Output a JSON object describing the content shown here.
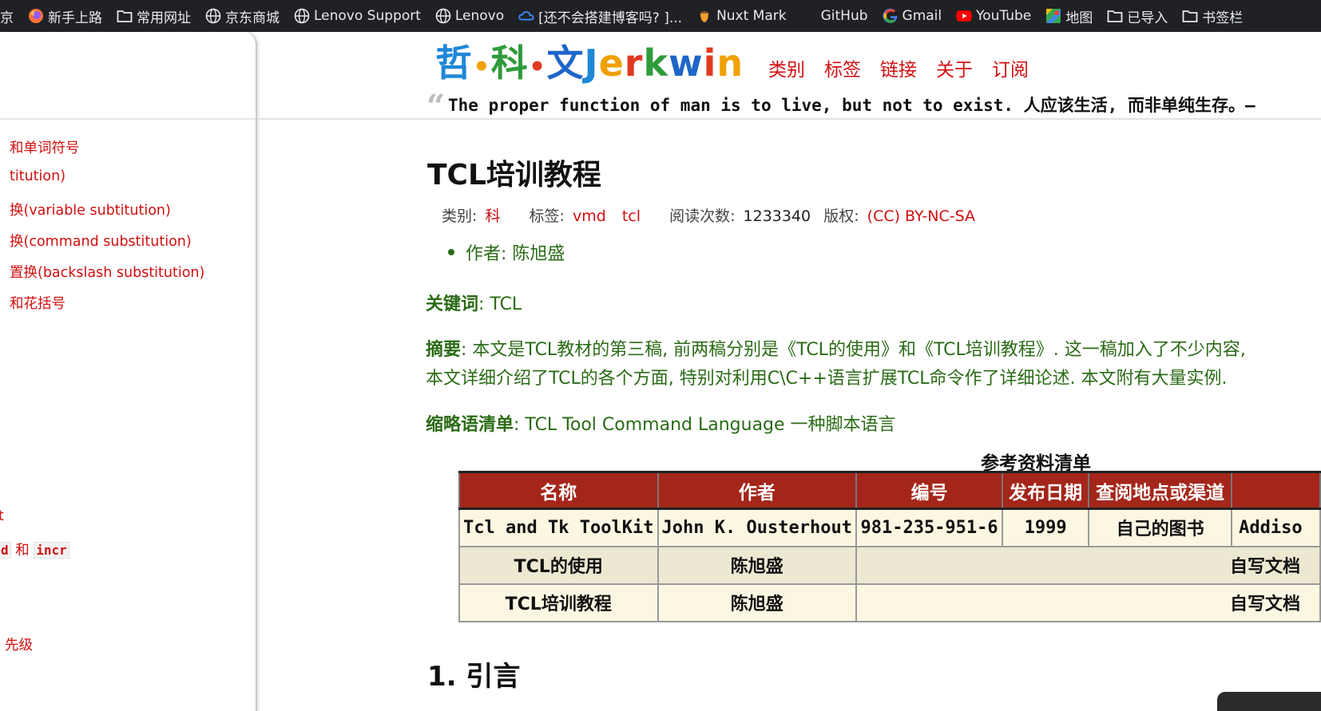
{
  "bookmarks": [
    {
      "label": "京",
      "icon": "partial-icon"
    },
    {
      "label": "新手上路",
      "icon": "firefox-icon"
    },
    {
      "label": "常用网址",
      "icon": "folder-icon"
    },
    {
      "label": "京东商城",
      "icon": "globe-icon"
    },
    {
      "label": "Lenovo Support",
      "icon": "globe-icon"
    },
    {
      "label": "Lenovo",
      "icon": "globe-icon"
    },
    {
      "label": "[还不会搭建博客吗? ]...",
      "icon": "cloud-icon"
    },
    {
      "label": "Nuxt Mark",
      "icon": "acorn-icon"
    },
    {
      "label": "GitHub",
      "icon": "github-icon"
    },
    {
      "label": "Gmail",
      "icon": "google-icon"
    },
    {
      "label": "YouTube",
      "icon": "youtube-icon"
    },
    {
      "label": "地图",
      "icon": "maps-icon"
    },
    {
      "label": "已导入",
      "icon": "folder-icon"
    },
    {
      "label": "书签栏",
      "icon": "folder-icon"
    }
  ],
  "sidebar": {
    "items": [
      {
        "label": "和单词符号"
      },
      {
        "label": "titution)"
      },
      {
        "label": "换(variable subtitution)"
      },
      {
        "label": "换(command substitution)"
      },
      {
        "label": "置换(backslash substitution)"
      },
      {
        "label": "和花括号"
      },
      {
        "label": "t"
      },
      {
        "label_code1": "d",
        "label_mid": " 和 ",
        "label_code2": "incr"
      },
      {
        "label": "先级"
      }
    ]
  },
  "header": {
    "logo": {
      "part1": "哲",
      "dot": "•",
      "part2": "科",
      "part3": "文",
      "J": "J",
      "e": "e",
      "r": "r",
      "k": "k",
      "w": "w",
      "i": "i",
      "n": "n"
    },
    "nav": [
      "类别",
      "标签",
      "链接",
      "关于",
      "订阅"
    ],
    "quote_mark": "“",
    "quote": "The proper function of man is to live, but not to exist. 人应该生活, 而非单纯生存。—"
  },
  "article": {
    "title": "TCL培训教程",
    "meta": {
      "category_label": "类别:",
      "category": "科",
      "tags_label": "标签:",
      "tag1": "vmd",
      "tag2": "tcl",
      "reads_label": "阅读次数:",
      "reads": "1233340",
      "license_label": "版权:",
      "license": "(CC) BY-NC-SA"
    },
    "author": "作者: 陈旭盛",
    "keywords_label": "关键词",
    "keywords": ": TCL",
    "abstract_label": "摘要",
    "abstract_line1": ": 本文是TCL教材的第三稿, 前两稿分别是《TCL的使用》和《TCL培训教程》. 这一稿加入了不少内容,",
    "abstract_line2": "本文详细介绍了TCL的各个方面, 特别对利用C\\C++语言扩展TCL命令作了详细论述. 本文附有大量实例.",
    "abbr_label": "缩略语清单",
    "abbr": ": TCL Tool Command Language 一种脚本语言",
    "table_caption": "参考资料清单",
    "table_headers": [
      "名称",
      "作者",
      "编号",
      "发布日期",
      "查阅地点或渠道",
      ""
    ],
    "table_rows": [
      [
        "Tcl and Tk ToolKit",
        "John K. Ousterhout",
        "981-235-951-6",
        "1999",
        "自己的图书",
        "Addiso"
      ],
      [
        "TCL的使用",
        "陈旭盛",
        "自写文档"
      ],
      [
        "TCL培训教程",
        "陈旭盛",
        "自写文档"
      ]
    ],
    "section1": "1. 引言"
  }
}
